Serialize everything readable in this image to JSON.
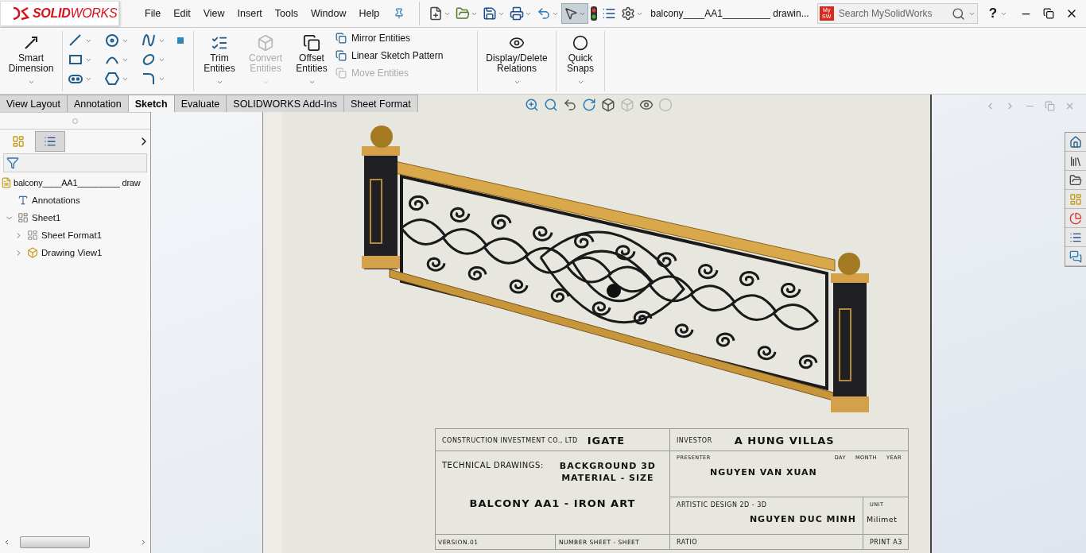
{
  "logo": {
    "brand": "SOLID",
    "rest": "WORKS"
  },
  "menu": [
    "File",
    "Edit",
    "View",
    "Insert",
    "Tools",
    "Window",
    "Help"
  ],
  "document_title": "balcony____AA1_________ drawin...",
  "search": {
    "placeholder": "Search MySolidWorks",
    "badge_top": "My",
    "badge_bottom": "SW"
  },
  "help_label": "?",
  "ribbon": {
    "smart_dimension": {
      "label": "Smart Dimension",
      "disabled": false
    },
    "large_commands": [
      {
        "label": "Trim Entities",
        "disabled": false
      },
      {
        "label": "Convert Entities",
        "disabled": true
      },
      {
        "label": "Offset Entities",
        "disabled": false
      }
    ],
    "list_commands": [
      {
        "label": "Mirror Entities",
        "disabled": false
      },
      {
        "label": "Linear Sketch Pattern",
        "disabled": false
      },
      {
        "label": "Move Entities",
        "disabled": true
      }
    ],
    "end_commands": [
      {
        "label": "Display/Delete Relations",
        "disabled": false
      },
      {
        "label": "Quick Snaps",
        "disabled": false
      }
    ]
  },
  "tabs": [
    {
      "label": "View Layout",
      "selected": false
    },
    {
      "label": "Annotation",
      "selected": false
    },
    {
      "label": "Sketch",
      "selected": true
    },
    {
      "label": "Evaluate",
      "selected": false
    },
    {
      "label": "SOLIDWORKS Add-Ins",
      "selected": false
    },
    {
      "label": "Sheet Format",
      "selected": false
    }
  ],
  "panel_tabs": [
    {
      "selected": false
    },
    {
      "selected": true
    }
  ],
  "tree": {
    "label": "balcony____AA1_________ draw",
    "children": [
      {
        "label": "Annotations",
        "kind": "annotations"
      },
      {
        "label": "Sheet1",
        "kind": "sheet",
        "expanded": true,
        "children": [
          {
            "label": "Sheet Format1",
            "kind": "format",
            "expanded": false
          },
          {
            "label": "Drawing View1",
            "kind": "view",
            "expanded": false
          }
        ]
      }
    ]
  },
  "title_block": {
    "company_label": "CONSTRUCTION INVESTMENT CO., LTD",
    "company": "IGATE",
    "investor_label": "INVESTOR",
    "investor": "A HUNG VILLAS",
    "drawings_label": "TECHNICAL DRAWINGS:",
    "drawings_line_1": "BACKGROUND 3D",
    "drawings_line_2": "MATERIAL - SIZE",
    "project": "BALCONY AA1 - IRON ART",
    "presenter_label": "PRESENTER",
    "day_label": "DAY",
    "month_label": "MONTH",
    "year_label": "YEAR",
    "presenter": "NGUYEN VAN XUAN",
    "design_label": "ARTISTIC DESIGN 2D - 3D",
    "designer": "NGUYEN DUC MINH",
    "unit_label": "UNIT",
    "unit": "Milimet",
    "version_label": "VERSION.01",
    "sheet_label": "NUMBER SHEET - SHEET",
    "ratio_label": "RATIO",
    "print_label": "PRINT A3"
  }
}
